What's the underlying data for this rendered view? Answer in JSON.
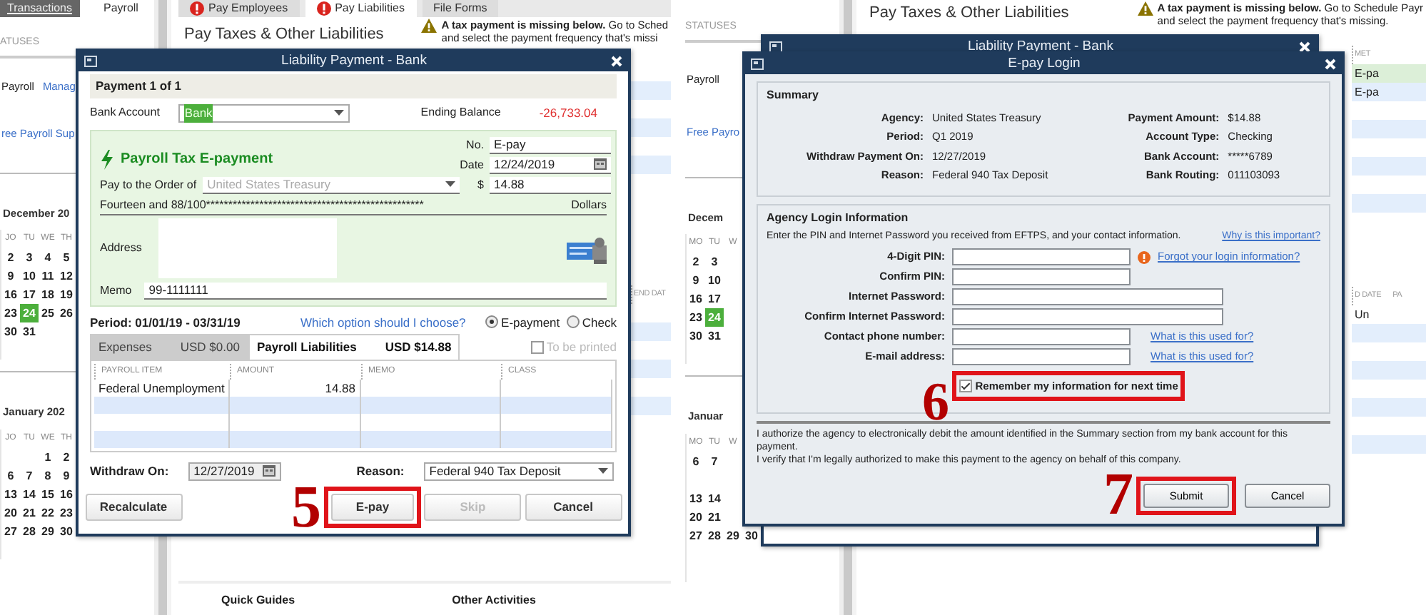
{
  "left_screen": {
    "app_tabs": [
      {
        "label": "Transactions",
        "selected": false
      },
      {
        "label": "Payroll",
        "selected": true
      }
    ],
    "sidebar": {
      "heading": "ATUSES",
      "rows": [
        [
          {
            "label": "Payroll",
            "kind": "text"
          },
          {
            "label": "Manag",
            "kind": "link"
          }
        ],
        [
          {
            "label": "ree Payroll Sup",
            "kind": "link"
          }
        ]
      ]
    },
    "calendars": [
      {
        "title": "December 20",
        "weekdays": [
          "JO",
          "TU",
          "WE",
          "TH"
        ],
        "weeks": [
          {
            "days": [
              {
                "d": "2",
                "selected": false
              },
              {
                "d": "3",
                "selected": false
              },
              {
                "d": "4",
                "selected": false
              },
              {
                "d": "5",
                "selected": false
              }
            ]
          },
          {
            "days": [
              {
                "d": "9",
                "selected": false
              },
              {
                "d": "10",
                "selected": false
              },
              {
                "d": "11",
                "selected": false
              },
              {
                "d": "12",
                "selected": false
              }
            ]
          },
          {
            "days": [
              {
                "d": "16",
                "selected": false
              },
              {
                "d": "17",
                "selected": false
              },
              {
                "d": "18",
                "selected": false
              },
              {
                "d": "19",
                "selected": false
              }
            ]
          },
          {
            "days": [
              {
                "d": "23",
                "selected": false
              },
              {
                "d": "24",
                "selected": true
              },
              {
                "d": "25",
                "selected": false
              },
              {
                "d": "26",
                "selected": false
              }
            ]
          },
          {
            "days": [
              {
                "d": "30",
                "selected": false
              },
              {
                "d": "31",
                "selected": false
              }
            ]
          }
        ]
      },
      {
        "title": "January 202",
        "weekdays": [
          "JO",
          "TU",
          "WE",
          "TH"
        ],
        "weeks": [
          {
            "days": [
              {
                "d": "1",
                "selected": false
              },
              {
                "d": "2",
                "selected": false
              }
            ],
            "pad_start": true
          },
          {
            "days": [
              {
                "d": "6",
                "selected": false
              },
              {
                "d": "7",
                "selected": false
              },
              {
                "d": "8",
                "selected": false
              },
              {
                "d": "9",
                "selected": false
              }
            ]
          },
          {
            "days": [
              {
                "d": "13",
                "selected": false
              },
              {
                "d": "14",
                "selected": false
              },
              {
                "d": "15",
                "selected": false
              },
              {
                "d": "16",
                "selected": false
              }
            ]
          },
          {
            "days": [
              {
                "d": "20",
                "selected": false
              },
              {
                "d": "21",
                "selected": false
              },
              {
                "d": "22",
                "selected": false
              },
              {
                "d": "23",
                "selected": false
              }
            ]
          },
          {
            "days": [
              {
                "d": "27",
                "selected": false
              },
              {
                "d": "28",
                "selected": false
              },
              {
                "d": "29",
                "selected": false
              },
              {
                "d": "30",
                "selected": false
              }
            ]
          }
        ]
      }
    ],
    "page_tabs": [
      {
        "label": "Pay Employees",
        "alert": true,
        "selected": false
      },
      {
        "label": "Pay Liabilities",
        "alert": true,
        "selected": true
      },
      {
        "label": "File Forms",
        "alert": false,
        "selected": false
      }
    ],
    "page_title": "Pay Taxes & Other Liabilities",
    "warning": {
      "text": "A tax payment is missing below.",
      "link": "Go to Sched",
      "line2": "and select the payment frequency that's missi"
    },
    "edge_column": [
      {
        "kind": "gap"
      },
      {
        "kind": "gap"
      },
      {
        "kind": "tint"
      },
      {
        "kind": "gap"
      },
      {
        "kind": "tint"
      },
      {
        "kind": "gap"
      },
      {
        "kind": "tint"
      },
      {
        "kind": "gap"
      },
      {
        "kind": "gap"
      },
      {
        "kind": "gap"
      },
      {
        "kind": "gap"
      },
      {
        "kind": "gap"
      },
      {
        "kind": "gap"
      },
      {
        "kind": "header",
        "cells": [
          "END DAT"
        ]
      },
      {
        "kind": "gap"
      },
      {
        "kind": "tint"
      },
      {
        "kind": "gap"
      },
      {
        "kind": "tint"
      },
      {
        "kind": "gap"
      },
      {
        "kind": "tint"
      }
    ],
    "sections": [
      "Quick Guides",
      "Other Activities"
    ],
    "dialogs": [
      {
        "kind": "liability_payment",
        "title": "Liability Payment - Bank",
        "header": "Payment 1 of 1",
        "bank_account": {
          "label": "Bank Account",
          "value": "Bank"
        },
        "ending_balance": {
          "label": "Ending Balance",
          "value": "-26,733.04"
        },
        "check": {
          "title": "Payroll Tax E-payment",
          "number_label": "No.",
          "number": "E-pay",
          "date_label": "Date",
          "date": "12/24/2019",
          "amount_label": "$",
          "amount": "14.88",
          "payee_label": "Pay to the Order of",
          "payee": "United States Treasury",
          "payee_disabled": true,
          "amount_words": "Fourteen and 88/100*************************************************",
          "currency": "Dollars",
          "address_label": "Address",
          "memo_label": "Memo",
          "memo": "99-1111111"
        },
        "period": "Period: 01/01/19 - 03/31/19",
        "help_link": "Which option should I choose?",
        "payment_methods": [
          {
            "label": "E-payment",
            "selected": true
          },
          {
            "label": "Check",
            "selected": false
          }
        ],
        "tabs": [
          {
            "label": "Expenses",
            "amount": "USD $0.00",
            "selected": false
          },
          {
            "label": "Payroll Liabilities",
            "amount": "USD $14.88",
            "selected": true
          }
        ],
        "to_be_printed": {
          "label": "To be printed",
          "checked": false,
          "disabled": true
        },
        "table": {
          "columns": [
            "PAYROLL ITEM",
            "AMOUNT",
            "MEMO",
            "CLASS"
          ],
          "rows": [
            {
              "payroll_item": "Federal Unemployment",
              "amount": "14.88"
            }
          ]
        },
        "withdraw_on": {
          "label": "Withdraw On:",
          "value": "12/27/2019"
        },
        "reason": {
          "label": "Reason:",
          "value": "Federal 940 Tax Deposit"
        },
        "buttons": [
          {
            "label": "Recalculate",
            "disabled": false
          },
          {
            "label": "E-pay",
            "disabled": false,
            "step": "5"
          },
          {
            "label": "Skip",
            "disabled": true
          },
          {
            "label": "Cancel",
            "disabled": false
          }
        ]
      }
    ]
  },
  "right_screen": {
    "sidebar": {
      "heading": "STATUSES",
      "rows": [
        [
          {
            "label": "Payroll",
            "kind": "text"
          }
        ],
        [
          {
            "label": "Free Payro",
            "kind": "link"
          }
        ]
      ]
    },
    "calendars": [
      {
        "title": "Decem",
        "weekdays": [
          "MO",
          "TU",
          "W"
        ],
        "weeks": [
          {
            "days": [
              {
                "d": "2",
                "selected": false
              },
              {
                "d": "3",
                "selected": false
              }
            ]
          },
          {
            "days": [
              {
                "d": "9",
                "selected": false
              },
              {
                "d": "10",
                "selected": false
              }
            ]
          },
          {
            "days": [
              {
                "d": "16",
                "selected": false
              },
              {
                "d": "17",
                "selected": false
              }
            ]
          },
          {
            "days": [
              {
                "d": "23",
                "selected": false
              },
              {
                "d": "24",
                "selected": true
              }
            ]
          },
          {
            "days": [
              {
                "d": "30",
                "selected": false
              },
              {
                "d": "31",
                "selected": false
              }
            ]
          }
        ]
      },
      {
        "title": "Januar",
        "weekdays": [
          "MO",
          "TU",
          "W"
        ],
        "weeks": [
          {
            "days": [
              {
                "d": "6",
                "selected": false
              },
              {
                "d": "7",
                "selected": false
              }
            ]
          },
          {
            "days": [
              {
                "d": "13",
                "selected": false
              },
              {
                "d": "14",
                "selected": false
              }
            ]
          },
          {
            "days": [
              {
                "d": "20",
                "selected": false
              },
              {
                "d": "21",
                "selected": false
              }
            ]
          },
          {
            "days": [
              {
                "d": "27",
                "selected": false
              },
              {
                "d": "28",
                "selected": false
              },
              {
                "d": "29",
                "selected": false
              },
              {
                "d": "30",
                "selected": false
              }
            ]
          }
        ]
      }
    ],
    "page_title": "Pay Taxes & Other Liabilities",
    "warning": {
      "text": "A tax payment is missing below.",
      "link": "Go to Schedule Payr",
      "line2": "and select the payment frequency that's missing."
    },
    "edge_column": [
      {
        "kind": "gap"
      },
      {
        "kind": "header",
        "cells": [
          "MET"
        ]
      },
      {
        "kind": "green",
        "cells": [
          "E-pa"
        ]
      },
      {
        "kind": "tint",
        "cells": [
          "E-pa"
        ]
      },
      {
        "kind": "gap"
      },
      {
        "kind": "tint"
      },
      {
        "kind": "gap"
      },
      {
        "kind": "tint"
      },
      {
        "kind": "gap"
      },
      {
        "kind": "tint"
      },
      {
        "kind": "gap"
      },
      {
        "kind": "gap"
      },
      {
        "kind": "gap"
      },
      {
        "kind": "gap"
      },
      {
        "kind": "header",
        "cells": [
          "D DATE",
          "PA"
        ]
      },
      {
        "kind": "row",
        "cells": [
          "Un"
        ]
      },
      {
        "kind": "tint"
      },
      {
        "kind": "gap"
      },
      {
        "kind": "tint"
      },
      {
        "kind": "gap"
      },
      {
        "kind": "tint"
      },
      {
        "kind": "gap"
      },
      {
        "kind": "tint"
      }
    ],
    "dialogs": [
      {
        "kind": "liability_behind",
        "title": "Liability Payment - Bank"
      },
      {
        "kind": "epay_login",
        "title": "E-pay Login",
        "summary": {
          "heading": "Summary",
          "left": [
            {
              "label": "Agency:",
              "value": "United States Treasury"
            },
            {
              "label": "Period:",
              "value": "Q1 2019"
            },
            {
              "label": "Withdraw Payment On:",
              "value": "12/27/2019"
            },
            {
              "label": "Reason:",
              "value": "Federal 940 Tax Deposit"
            }
          ],
          "right": [
            {
              "label": "Payment Amount:",
              "value": "$14.88"
            },
            {
              "label": "Account Type:",
              "value": "Checking"
            },
            {
              "label": "Bank Account:",
              "value": "*****6789"
            },
            {
              "label": "Bank Routing:",
              "value": "011103093"
            }
          ]
        },
        "login": {
          "heading": "Agency Login Information",
          "intro": "Enter the PIN and Internet Password you received from EFTPS, and your contact information.",
          "help_link": "Why is this important?",
          "fields": [
            {
              "label": "4-Digit PIN:",
              "kind": "short",
              "alert": true,
              "link": "Forgot your login information?"
            },
            {
              "label": "Confirm PIN:",
              "kind": "short",
              "alert": false
            },
            {
              "label": "Internet Password:",
              "kind": "long",
              "alert": false
            },
            {
              "label": "Confirm Internet Password:",
              "kind": "long",
              "alert": false
            },
            {
              "label": "Contact phone number:",
              "kind": "short",
              "alert": false,
              "link": "What is this used for?"
            },
            {
              "label": "E-mail address:",
              "kind": "short",
              "alert": false,
              "link": "What is this used for?"
            }
          ],
          "remember": {
            "label": "Remember my information for next time",
            "checked": true,
            "step": "6"
          }
        },
        "authorization": [
          "I authorize the agency to electronically debit the amount identified in the Summary section from my bank account for this payment.",
          "I verify that I'm legally authorized to make this payment to the agency on behalf of this company."
        ],
        "buttons": [
          {
            "label": "Submit",
            "step": "7"
          },
          {
            "label": "Cancel"
          }
        ]
      }
    ]
  }
}
